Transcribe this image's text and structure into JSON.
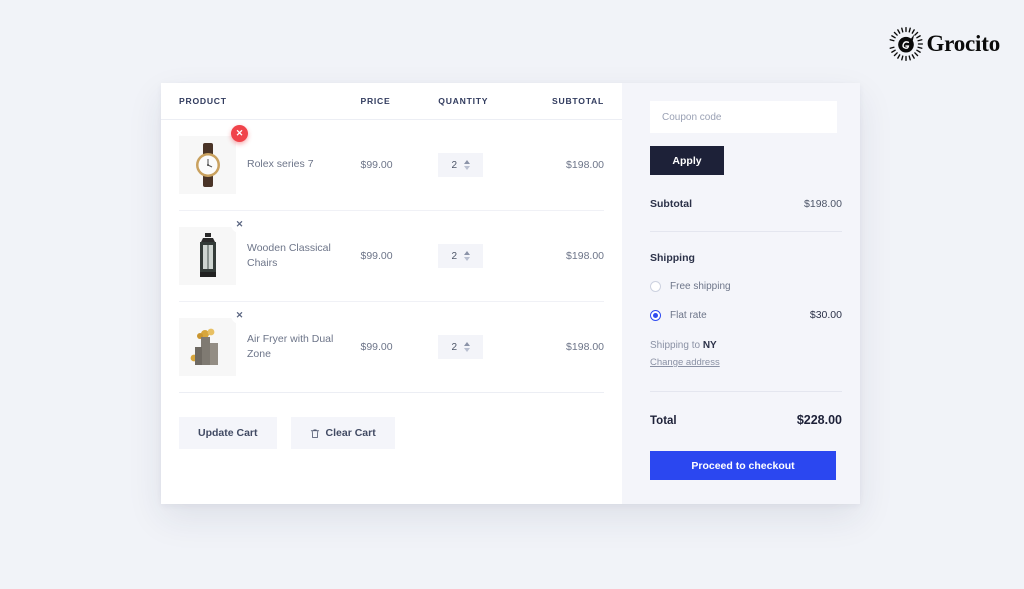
{
  "brand": {
    "name": "Grocito",
    "logo_icon": "grocito-sunburst-logo"
  },
  "cart": {
    "columns": {
      "product": "PRODUCT",
      "price": "PRICE",
      "quantity": "QUANTITY",
      "subtotal": "SUBTOTAL"
    },
    "items": [
      {
        "name": "Rolex series 7",
        "price": "$99.00",
        "qty": "2",
        "subtotal": "$198.00",
        "image_icon": "wristwatch-thumbnail",
        "remove_icon": "close-icon",
        "remove_active": true
      },
      {
        "name": "Wooden Classical Chairs",
        "price": "$99.00",
        "qty": "2",
        "subtotal": "$198.00",
        "image_icon": "lantern-thumbnail",
        "remove_icon": "close-icon",
        "remove_active": false
      },
      {
        "name": "Air Fryer with Dual Zone",
        "price": "$99.00",
        "qty": "2",
        "subtotal": "$198.00",
        "image_icon": "vases-with-flowers-thumbnail",
        "remove_icon": "close-icon",
        "remove_active": false
      }
    ],
    "actions": {
      "update_label": "Update Cart",
      "clear_label": "Clear Cart",
      "clear_icon": "trash-icon"
    }
  },
  "summary": {
    "coupon_placeholder": "Coupon code",
    "coupon_value": "",
    "apply_label": "Apply",
    "subtotal_label": "Subtotal",
    "subtotal_value": "$198.00",
    "shipping_title": "Shipping",
    "options": [
      {
        "label": "Free shipping",
        "price": "",
        "selected": false
      },
      {
        "label": "Flat rate",
        "price": "$30.00",
        "selected": true
      }
    ],
    "shipping_to_prefix": "Shipping to ",
    "shipping_to_region": "NY",
    "change_address_label": "Change address",
    "total_label": "Total",
    "total_value": "$228.00",
    "checkout_label": "Proceed to checkout"
  },
  "colors": {
    "page_bg": "#f1f3f8",
    "card_bg": "#ffffff",
    "summary_bg": "#f4f5fa",
    "apply_bg": "#1d2138",
    "checkout_bg": "#2b47f0",
    "accent_blue": "#2f4bf0",
    "remove_active": "#f0434a"
  }
}
